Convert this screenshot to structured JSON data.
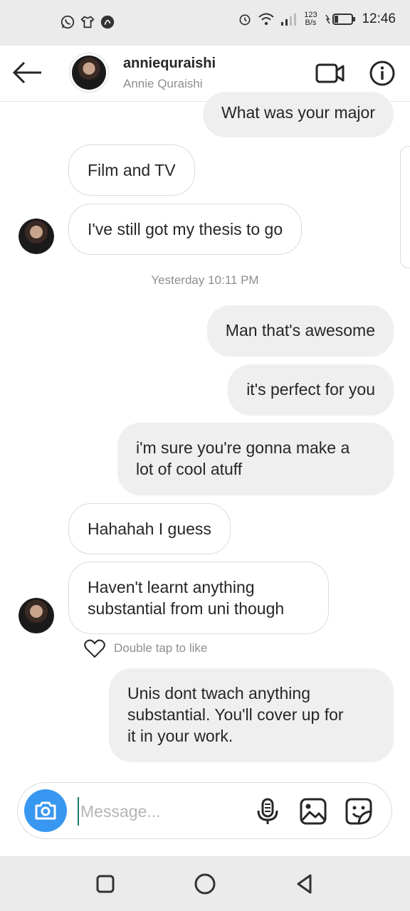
{
  "status_bar": {
    "left_icons": [
      "whatsapp-icon",
      "tshirt-icon",
      "app-icon"
    ],
    "net_speed_value": "123",
    "net_speed_unit": "B/s",
    "time": "12:46"
  },
  "header": {
    "username": "anniequraishi",
    "full_name": "Annie Quraishi",
    "icons": {
      "back": "back-arrow-icon",
      "video": "video-call-icon",
      "info": "info-icon"
    }
  },
  "messages": [
    {
      "side": "out",
      "text": "What was your major"
    },
    {
      "side": "in",
      "text": "Film and TV"
    },
    {
      "side": "in",
      "text": "I've still got my thesis to go"
    },
    {
      "type": "timestamp",
      "text": "Yesterday 10:11 PM"
    },
    {
      "side": "out",
      "text": "Man that's awesome"
    },
    {
      "side": "out",
      "text": "it's perfect for you"
    },
    {
      "side": "out",
      "text": "i'm sure you're gonna make a\nlot of cool atuff"
    },
    {
      "side": "in",
      "text": "Hahahah I guess"
    },
    {
      "side": "in",
      "text": "Haven't learnt anything\nsubstantial from uni though"
    },
    {
      "side": "out",
      "text": "Unis dont twach anything\nsubstantial. You'll cover up for\nit in your work."
    }
  ],
  "like_hint": "Double tap to like",
  "composer": {
    "placeholder": "Message...",
    "icons": [
      "camera-icon",
      "microphone-icon",
      "gallery-icon",
      "sticker-icon"
    ]
  },
  "nav_bar": {
    "icons": [
      "recents-icon",
      "home-icon",
      "back-icon"
    ]
  },
  "colors": {
    "accent_blue": "#3897f0",
    "bubble_out": "#efefef",
    "bar_gray": "#ebebeb"
  }
}
